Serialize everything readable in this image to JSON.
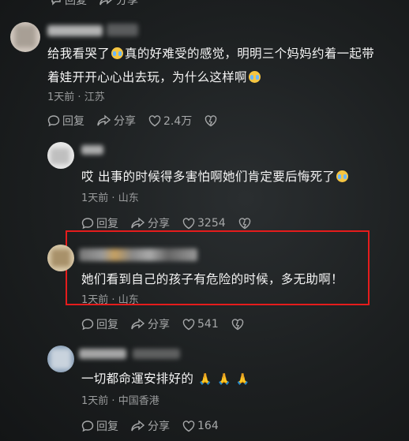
{
  "comments": [
    {
      "text_line1": "给我看哭了",
      "text_line1b": "真的好难受的感觉，明明三个妈妈约着一起带",
      "text_line2": "着娃开开心心出去玩，为什么这样啊",
      "time": "1天前",
      "location": "江苏",
      "reply_label": "回复",
      "share_label": "分享",
      "likes": "2.4万"
    },
    {
      "text": "哎 出事的时候得多害怕啊她们肯定要后悔死了",
      "time": "1天前",
      "location": "山东",
      "reply_label": "回复",
      "share_label": "分享",
      "likes": "3254"
    },
    {
      "text": "她们看到自己的孩子有危险的时候，多无助啊！",
      "time": "1天前",
      "location": "山东",
      "reply_label": "回复",
      "share_label": "分享",
      "likes": "541"
    },
    {
      "text": "一切都命運安排好的",
      "time": "1天前",
      "location": "中国香港",
      "reply_label": "回复",
      "share_label": "分享",
      "likes": "164"
    }
  ],
  "top_cut": {
    "reply_label": "回复",
    "share_label": "分享"
  },
  "colors": {
    "highlight_border": "#e51c1c",
    "meta_text": "#9a9c9d"
  },
  "icons": [
    "reply-icon",
    "share-icon",
    "heart-icon",
    "dislike-icon",
    "crying-emoji",
    "pray-emoji"
  ]
}
